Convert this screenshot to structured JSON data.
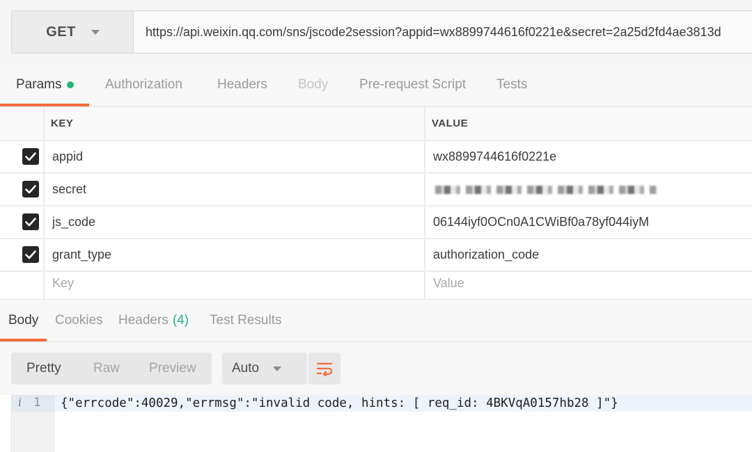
{
  "request": {
    "method": "GET",
    "url": "https://api.weixin.qq.com/sns/jscode2session?appid=wx8899744616f0221e&secret=2a25d2fd4ae3813d"
  },
  "request_tabs": [
    {
      "label": "Params",
      "active": true
    },
    {
      "label": "Authorization"
    },
    {
      "label": "Headers"
    },
    {
      "label": "Body",
      "disabled": true
    },
    {
      "label": "Pre-request Script"
    },
    {
      "label": "Tests"
    }
  ],
  "params": {
    "key_header": "KEY",
    "value_header": "VALUE",
    "rows": [
      {
        "checked": true,
        "key": "appid",
        "value": "wx8899744616f0221e"
      },
      {
        "checked": true,
        "key": "secret",
        "value": ""
      },
      {
        "checked": true,
        "key": "js_code",
        "value": "06144iyf0OCn0A1CWiBf0a78yf044iyM"
      },
      {
        "checked": true,
        "key": "grant_type",
        "value": "authorization_code"
      }
    ],
    "key_placeholder": "Key",
    "value_placeholder": "Value"
  },
  "response_tabs": [
    {
      "label": "Body",
      "active": true
    },
    {
      "label": "Cookies"
    },
    {
      "label": "Headers",
      "count": "(4)"
    },
    {
      "label": "Test Results"
    }
  ],
  "toolbar": {
    "modes": [
      "Pretty",
      "Raw",
      "Preview"
    ],
    "active_mode": "Pretty",
    "format": "Auto"
  },
  "response_body": {
    "line_number": "1",
    "info_icon": "i",
    "text": "{\"errcode\":40029,\"errmsg\":\"invalid code, hints: [ req_id: 4BKVqA0157hb28 ]\"}"
  },
  "colors": {
    "accent": "#f26b3a",
    "status_green": "#27b47a"
  }
}
